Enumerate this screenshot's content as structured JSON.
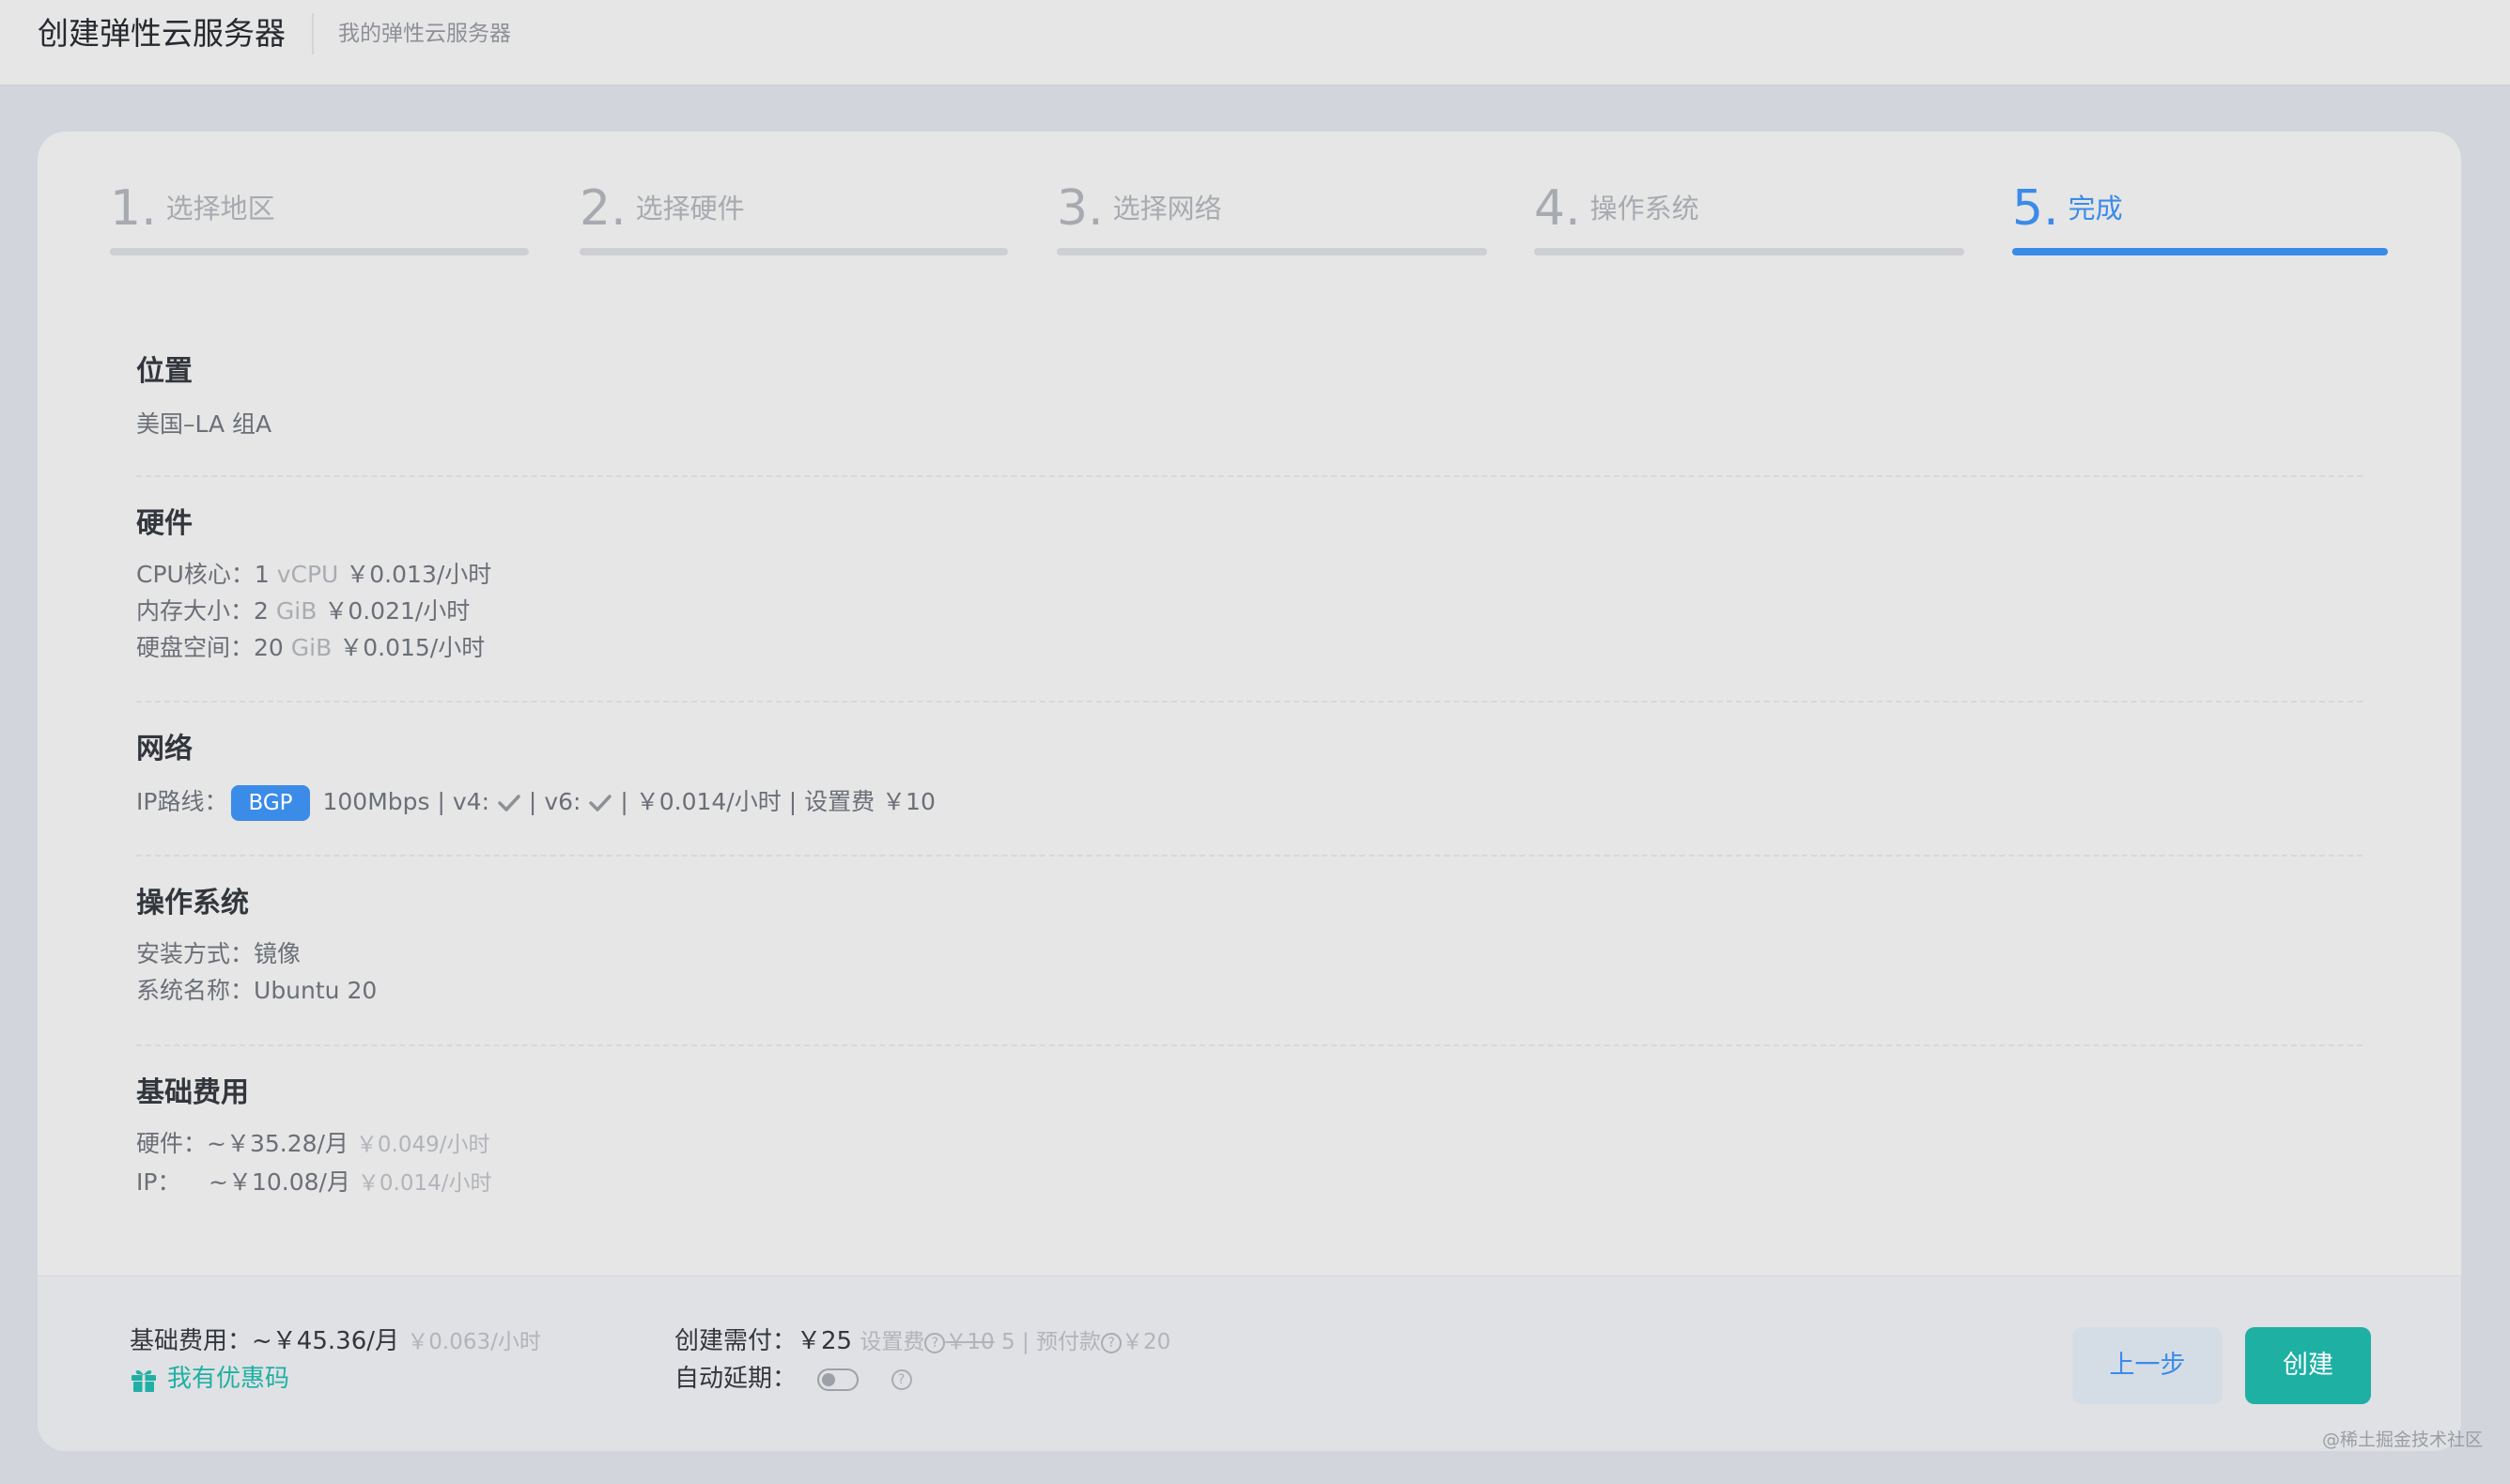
{
  "header": {
    "title": "创建弹性云服务器",
    "breadcrumb": "我的弹性云服务器"
  },
  "steps": [
    {
      "num": "1.",
      "label": "选择地区",
      "active": false
    },
    {
      "num": "2.",
      "label": "选择硬件",
      "active": false
    },
    {
      "num": "3.",
      "label": "选择网络",
      "active": false
    },
    {
      "num": "4.",
      "label": "操作系统",
      "active": false
    },
    {
      "num": "5.",
      "label": "完成",
      "active": true
    }
  ],
  "location": {
    "title": "位置",
    "value": "美国–LA 组A"
  },
  "hardware": {
    "title": "硬件",
    "cpu": {
      "label": "CPU核心：",
      "value": "1",
      "unit": "vCPU",
      "price": "￥0.013/小时"
    },
    "memory": {
      "label": "内存大小：",
      "value": "2",
      "unit": "GiB",
      "price": "￥0.021/小时"
    },
    "disk": {
      "label": "硬盘空间：",
      "value": "20",
      "unit": "GiB",
      "price": "￥0.015/小时"
    }
  },
  "network": {
    "title": "网络",
    "route_label": "IP路线：",
    "route_tag": "BGP",
    "bandwidth": "100Mbps",
    "pipe": "|",
    "v4_label": "v4:",
    "v6_label": "v6:",
    "price": "￥0.014/小时",
    "setup_label": "设置费",
    "setup_price": "￥10"
  },
  "os": {
    "title": "操作系统",
    "install": {
      "label": "安装方式：",
      "value": "镜像"
    },
    "name": {
      "label": "系统名称：",
      "value": "Ubuntu 20"
    }
  },
  "base_fee": {
    "title": "基础费用",
    "hardware": {
      "label": "硬件：",
      "value": "~￥35.28/月",
      "hourly": "￥0.049/小时"
    },
    "ip": {
      "label": "IP：",
      "value": "~￥10.08/月",
      "hourly": "￥0.014/小时"
    }
  },
  "footer": {
    "base_label": "基础费用：",
    "base_value": "~￥45.36/月",
    "base_hourly": "￥0.063/小时",
    "coupon": "我有优惠码",
    "pay_label": "创建需付：",
    "pay_value": "￥25",
    "setup_label": "设置费",
    "q_mark": "?",
    "setup_old": "￥10",
    "setup_new": "5",
    "prepay_label": "预付款",
    "prepay_value": "￥20",
    "auto_renew_label": "自动延期：",
    "auto_renew_on": false,
    "prev_button": "上一步",
    "create_button": "创建"
  },
  "watermark": "@稀土掘金技术社区",
  "colors": {
    "accent": "#3b8be8",
    "create": "#1fb0a4"
  }
}
